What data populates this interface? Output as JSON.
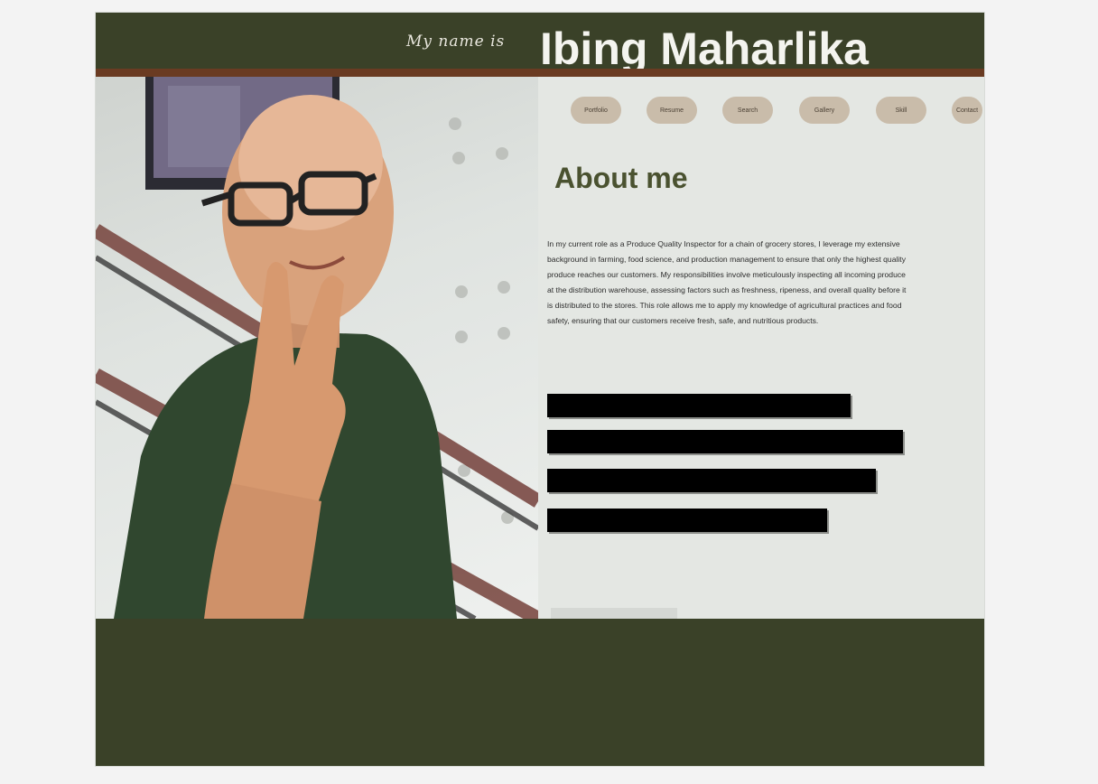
{
  "header": {
    "greeting": "My name is",
    "name": "Ibing Maharlika"
  },
  "nav": {
    "items": [
      {
        "label": "Portfolio"
      },
      {
        "label": "Resume"
      },
      {
        "label": "Search"
      },
      {
        "label": "Gallery"
      },
      {
        "label": "Skill"
      },
      {
        "label": "Contact"
      }
    ]
  },
  "about": {
    "title": "About me",
    "body": "In my current role as a Produce Quality Inspector for a chain of grocery stores, I leverage my extensive background in farming, food science, and production management to ensure that only the highest quality produce reaches our customers. My responsibilities involve meticulously inspecting all incoming produce at the distribution warehouse, assessing factors such as freshness, ripeness, and overall quality before it is distributed to the stores. This role allows me to apply my knowledge of agricultural practices and food safety, ensuring that our customers receive fresh, safe, and nutritious products."
  },
  "colors": {
    "header_bg": "#3a4128",
    "accent_rule": "#6a3b22",
    "nav_pill": "#c9bcaa",
    "title": "#4a5230",
    "panel_bg": "#e4e7e3"
  },
  "photo": {
    "icon": "profile-photo-icon"
  }
}
